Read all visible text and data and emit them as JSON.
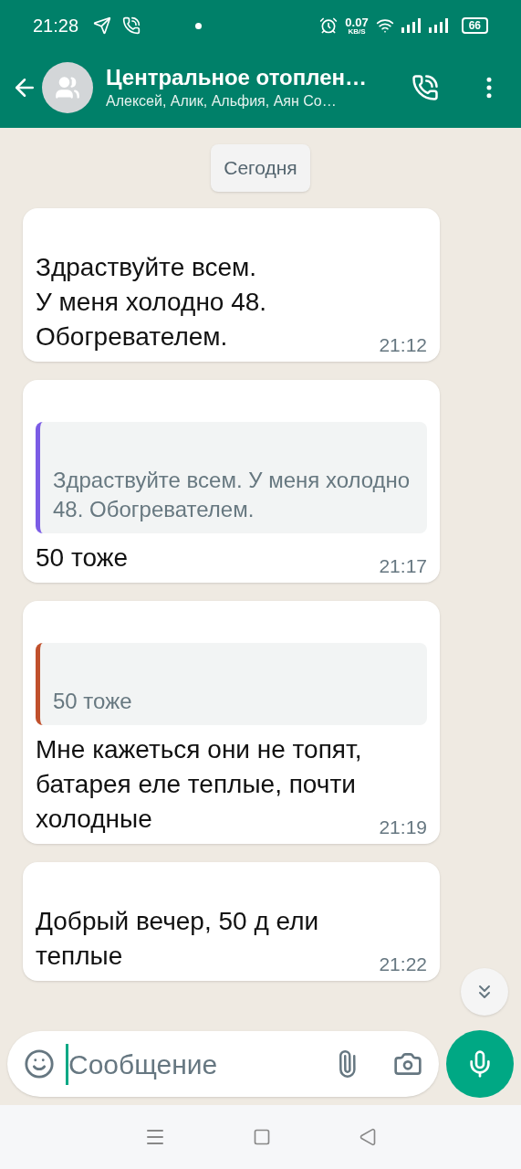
{
  "status_bar": {
    "time": "21:28",
    "net_speed": "0.07",
    "net_unit": "KB/S",
    "battery": "66"
  },
  "header": {
    "title": "Центральное отоплен…",
    "members": "Алексей, Алик, Альфия, Аян Со…"
  },
  "date_chip": "Сегодня",
  "messages": [
    {
      "text": "Здраствуйте всем.\nУ меня холодно 48.\nОбогревателем.",
      "time": "21:12"
    },
    {
      "quote": {
        "text": "Здраствуйте всем. У меня холодно 48. Обогревателем.",
        "color": "#7b5ce5"
      },
      "text": "50 тоже",
      "time": "21:17"
    },
    {
      "quote": {
        "text": "50 тоже",
        "color": "#c0502c"
      },
      "text": "Мне кажеться они не топят, батарея еле теплые, почти холодные",
      "time": "21:19"
    },
    {
      "text": "Добрый вечер, 50 д ели теплые",
      "time": "21:22"
    }
  ],
  "composer": {
    "placeholder": "Сообщение"
  }
}
